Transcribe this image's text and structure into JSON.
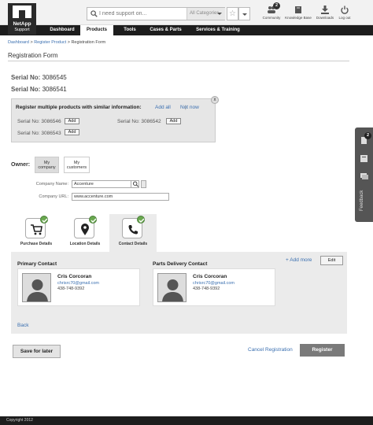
{
  "brand": {
    "line1": "NetApp",
    "line2": "Support"
  },
  "search": {
    "placeholder": "I need support on...",
    "category": "All Categories"
  },
  "toolbar": [
    {
      "label": "Community",
      "badge": "2"
    },
    {
      "label": "Knowledge Base"
    },
    {
      "label": "Downloads"
    },
    {
      "label": "Log out"
    }
  ],
  "nav": [
    "Dashboard",
    "Products",
    "Tools",
    "Cases & Parts",
    "Services & Training"
  ],
  "breadcrumb": {
    "link1": "Dashboard",
    "link2": "Register Product",
    "current": "Registration Form",
    "sep": " > "
  },
  "page_title": "Registration Form",
  "serials": [
    {
      "label": "Serial No:",
      "value": "3086545"
    },
    {
      "label": "Serial No:",
      "value": "3086541"
    }
  ],
  "multi": {
    "heading": "Register multiple products with similar information:",
    "add_all": "Add all",
    "sep": "|",
    "not_now": "Not now",
    "close": "x",
    "items": [
      {
        "label": "Serial No: 3086546",
        "button": "Add"
      },
      {
        "label": "Serial No: 3086542",
        "button": "Add"
      },
      {
        "label": "Serial No: 3086543",
        "button": "Add"
      }
    ]
  },
  "owner": {
    "label": "Owner:",
    "my_company": "My company",
    "my_customers": "My customers"
  },
  "company": {
    "name_label": "Company Name:",
    "name_value": "Accenture",
    "url_label": "Company URL:",
    "url_value": "www.accenture.com"
  },
  "tabs": [
    {
      "label": "Purchase Details"
    },
    {
      "label": "Location Details"
    },
    {
      "label": "Contact Details"
    }
  ],
  "contacts": {
    "primary_title": "Primary Contact",
    "parts_title": "Parts Delivery Contact",
    "add_more": "+ Add more",
    "edit": "Edit",
    "primary": {
      "name": "Cris Corcoran",
      "email": "chrisrc70@gmail.com",
      "phone": "438-748-9392"
    },
    "parts": {
      "name": "Cris Corcoran",
      "email": "chrisrc70@gmail.com",
      "phone": "438-748-9392"
    },
    "back": "Back"
  },
  "actions": {
    "save": "Save for later",
    "cancel": "Cancel Registration",
    "register": "Register"
  },
  "rail": {
    "badge": "2",
    "feedback": "Feedback"
  },
  "footer": "Copyright 2012",
  "colors": {
    "dark": "#1d1d1d",
    "link": "#3a6fb0",
    "check": "#6aa84f",
    "primary_button": "#7a7a7a"
  }
}
